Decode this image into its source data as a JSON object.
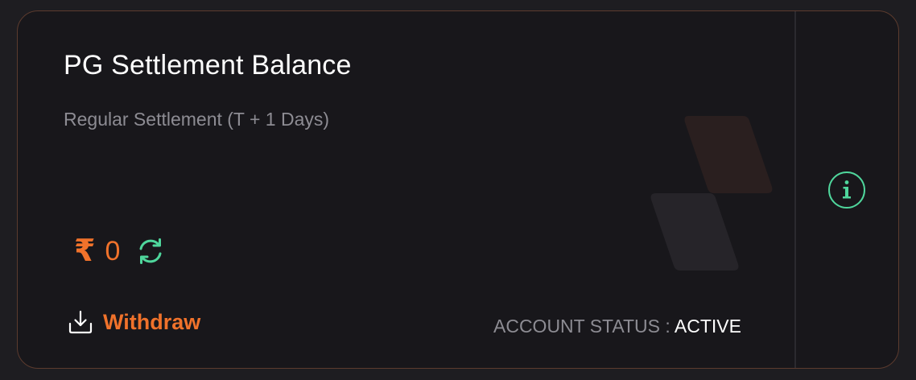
{
  "card": {
    "title": "PG Settlement Balance",
    "subtitle": "Regular Settlement (T + 1 Days)"
  },
  "balance": {
    "currency_symbol": "₹",
    "amount": "0"
  },
  "actions": {
    "withdraw_label": "Withdraw"
  },
  "status": {
    "label": "ACCOUNT STATUS : ",
    "value": "ACTIVE"
  },
  "icons": {
    "refresh": "refresh-icon",
    "withdraw": "download-icon",
    "info": "info-icon"
  },
  "colors": {
    "accent": "#f0722b",
    "success": "#4fd69c",
    "background": "#18171b",
    "border": "#5c3b2e",
    "muted_text": "#8d8c93"
  }
}
